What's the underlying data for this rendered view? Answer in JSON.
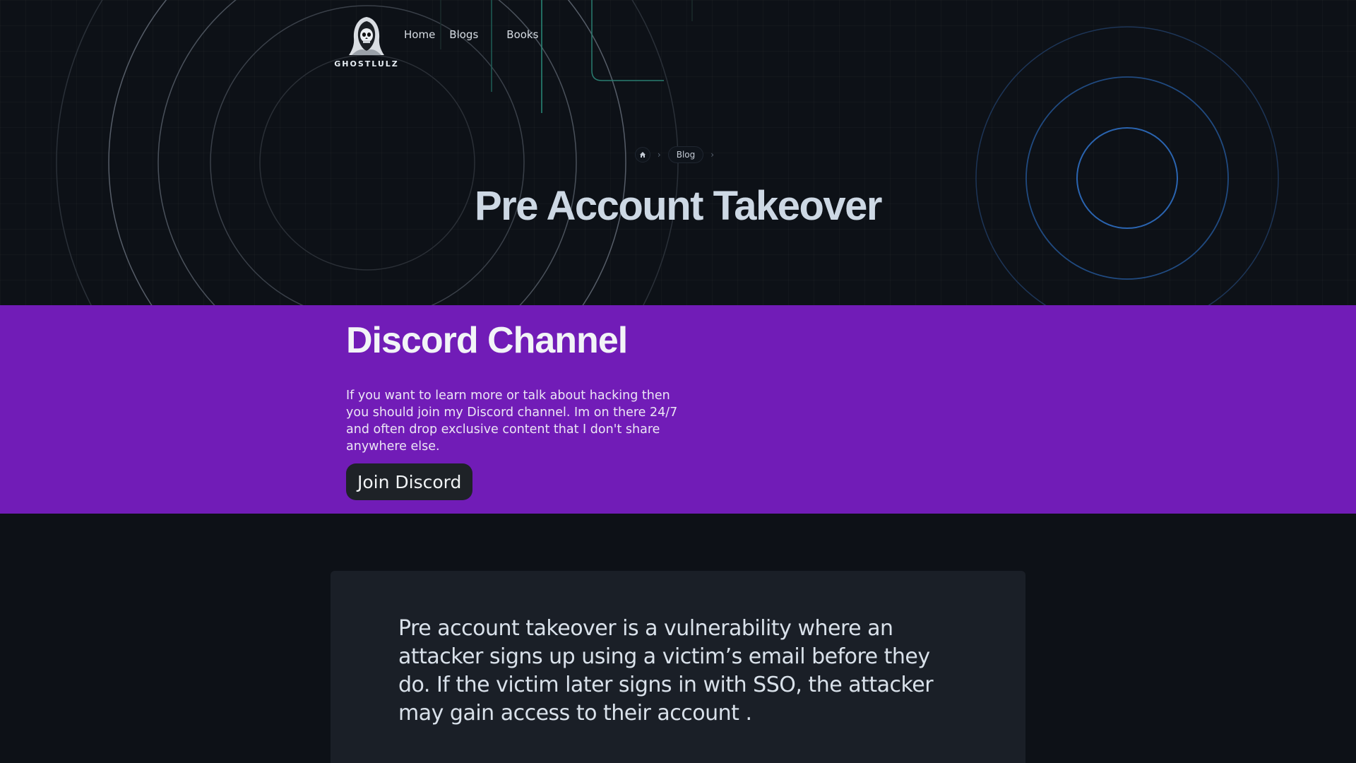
{
  "nav": {
    "logo_text": "GHOSTLULZ",
    "links": [
      {
        "label": "Home"
      },
      {
        "label": "Blogs"
      },
      {
        "label": "Books"
      }
    ]
  },
  "breadcrumb": {
    "home_icon": "home-icon",
    "items": [
      {
        "label": "Blog"
      }
    ]
  },
  "hero": {
    "title": "Pre Account Takeover"
  },
  "discord": {
    "heading": "Discord Channel",
    "text": "If you want to learn more or talk about hacking then you should join my Discord channel. Im on there 24/7 and often drop exclusive content that I don't share anywhere else.",
    "button_label": "Join Discord",
    "background": "#711cb7"
  },
  "article": {
    "intro": "Pre account takeover is a vulnerability where an attacker signs up using a victim’s email before they do. If the victim later signs in with SSO, the attacker may gain access to their account ."
  },
  "colors": {
    "page_bg": "#0d1117",
    "card_bg": "#1a1f27",
    "accent_teal": "#2fbfa5",
    "accent_blue": "#2f6fbf"
  }
}
